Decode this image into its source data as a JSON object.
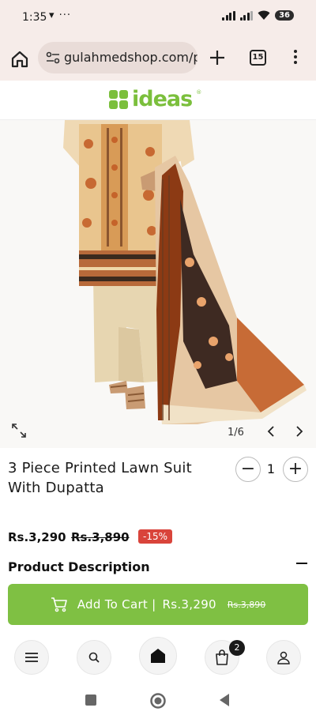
{
  "status_bar": {
    "time": "1:35",
    "left_icons": "▾ ···",
    "battery": "36"
  },
  "browser": {
    "url": "gulahmedshop.com/p",
    "tab_count": "15"
  },
  "site": {
    "logo_text": "ideas"
  },
  "gallery": {
    "counter": "1/6"
  },
  "product": {
    "title": "3 Piece Printed Lawn Suit With Dupatta",
    "quantity": "1",
    "qty_minus": "−",
    "qty_plus": "+",
    "price": "Rs.3,290",
    "old_price": "Rs.3,890",
    "discount": "-15%"
  },
  "description": {
    "heading": "Product Description"
  },
  "add_to_cart": {
    "label": "Add To Cart |",
    "price": "Rs.3,290",
    "old_price": "Rs.3,890"
  },
  "bottom_nav": {
    "cart_count": "2"
  },
  "colors": {
    "brand_green": "#7bbf3c",
    "button_green": "#7fc043",
    "discount_red": "#d9443b"
  },
  "icons": [
    "home-icon",
    "site-settings-icon",
    "plus-icon",
    "tabs-icon",
    "menu-icon",
    "expand-icon",
    "chevron-left-icon",
    "chevron-right-icon",
    "cart-icon",
    "hamburger-icon",
    "search-icon",
    "shop-home-icon",
    "shopping-bag-icon",
    "user-icon"
  ]
}
